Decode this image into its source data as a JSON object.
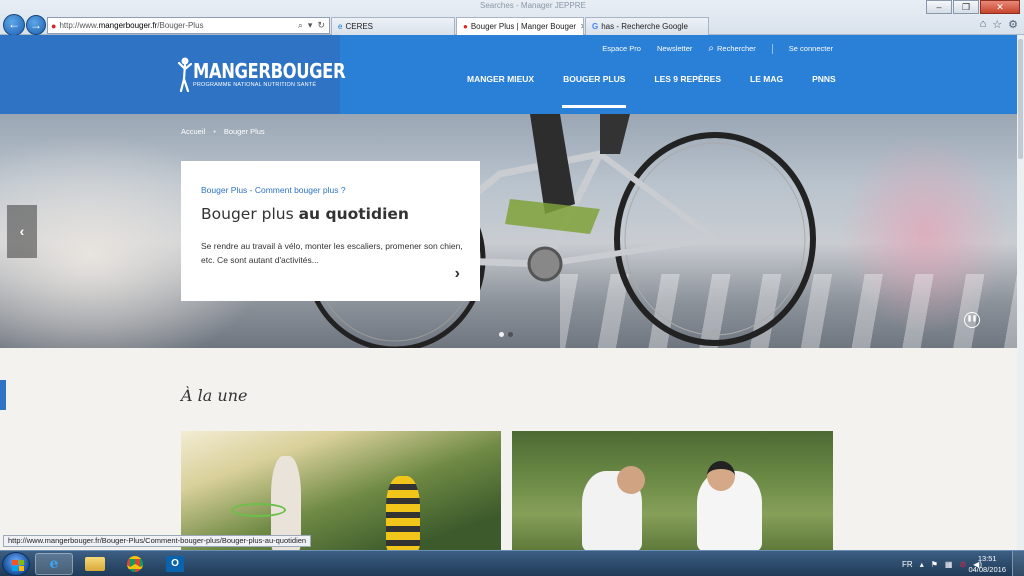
{
  "browser": {
    "title_bar": "Searches - Manager JEPPRE",
    "address_url_prefix": "http://www.",
    "address_url_domain": "mangerbouger.fr",
    "address_url_path": "/Bouger-Plus",
    "tabs": [
      {
        "label": "CERES",
        "icon": "ie-icon"
      },
      {
        "label": "Bouger Plus | Manger Bouger",
        "icon": "apple-icon",
        "active": true
      },
      {
        "label": "has - Recherche Google",
        "icon": "google-icon"
      }
    ],
    "status_url": "http://www.mangerbouger.fr/Bouger-Plus/Comment-bouger-plus/Bouger-plus-au-quotidien"
  },
  "header": {
    "logo_text": "MANGERBOUGER",
    "logo_subtitle": "PROGRAMME NATIONAL NUTRITION SANTÉ",
    "util_nav": [
      "Espace Pro",
      "Newsletter",
      "Rechercher",
      "Se connecter"
    ],
    "main_nav": [
      {
        "label": "MANGER MIEUX"
      },
      {
        "label": "BOUGER PLUS",
        "active": true
      },
      {
        "label": "LES 9 REPÈRES"
      },
      {
        "label": "LE MAG"
      },
      {
        "label": "PNNS"
      }
    ]
  },
  "hero": {
    "breadcrumb": [
      "Accueil",
      "Bouger Plus"
    ],
    "kicker": "Bouger Plus - Comment bouger plus ?",
    "title_plain": "Bouger plus ",
    "title_bold": "au quotidien",
    "description": "Se rendre au travail à vélo, monter les escaliers, promener son chien, etc. Ce sont autant d'activités...",
    "slide_count": 2,
    "active_slide": 1
  },
  "section": {
    "title": "À la une"
  },
  "taskbar": {
    "lang": "FR",
    "time": "13:51",
    "date": "04/08/2016"
  }
}
